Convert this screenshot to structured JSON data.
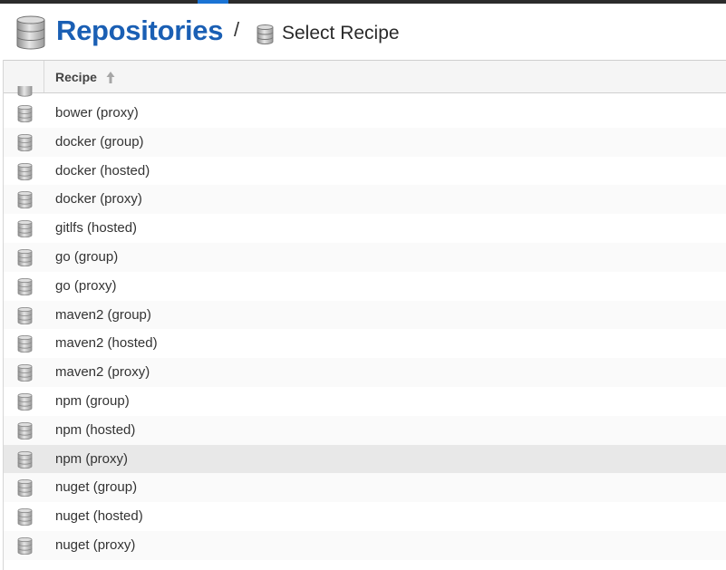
{
  "header": {
    "title": "Repositories",
    "separator": "/",
    "subtitle": "Select Recipe"
  },
  "grid": {
    "column_header": "Recipe",
    "sort_icon": "sort-ascending-icon",
    "rows": [
      {
        "label": "bower (proxy)"
      },
      {
        "label": "docker (group)"
      },
      {
        "label": "docker (hosted)"
      },
      {
        "label": "docker (proxy)"
      },
      {
        "label": "gitlfs (hosted)"
      },
      {
        "label": "go (group)"
      },
      {
        "label": "go (proxy)"
      },
      {
        "label": "maven2 (group)"
      },
      {
        "label": "maven2 (hosted)"
      },
      {
        "label": "maven2 (proxy)"
      },
      {
        "label": "npm (group)"
      },
      {
        "label": "npm (hosted)"
      },
      {
        "label": "npm (proxy)",
        "selected": true
      },
      {
        "label": "nuget (group)"
      },
      {
        "label": "nuget (hosted)"
      },
      {
        "label": "nuget (proxy)"
      }
    ]
  },
  "colors": {
    "title": "#1a5fb4",
    "accent_tab": "#1a73d4",
    "selected_row": "#e8e8e8"
  }
}
